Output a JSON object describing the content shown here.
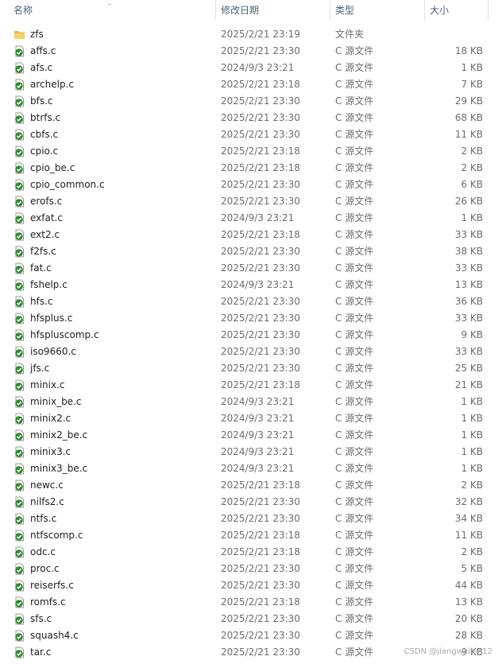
{
  "columns": {
    "name": "名称",
    "date": "修改日期",
    "type": "类型",
    "size": "大小"
  },
  "files": [
    {
      "name": "zfs",
      "date": "2025/2/21 23:19",
      "type": "文件夹",
      "size": "",
      "icon": "folder-icon"
    },
    {
      "name": "affs.c",
      "date": "2025/2/21 23:30",
      "type": "C 源文件",
      "size": "18 KB",
      "icon": "c-source-file-icon"
    },
    {
      "name": "afs.c",
      "date": "2024/9/3 23:21",
      "type": "C 源文件",
      "size": "1 KB",
      "icon": "c-source-file-icon"
    },
    {
      "name": "archelp.c",
      "date": "2025/2/21 23:18",
      "type": "C 源文件",
      "size": "7 KB",
      "icon": "c-source-file-icon"
    },
    {
      "name": "bfs.c",
      "date": "2025/2/21 23:30",
      "type": "C 源文件",
      "size": "29 KB",
      "icon": "c-source-file-icon"
    },
    {
      "name": "btrfs.c",
      "date": "2025/2/21 23:30",
      "type": "C 源文件",
      "size": "68 KB",
      "icon": "c-source-file-icon"
    },
    {
      "name": "cbfs.c",
      "date": "2025/2/21 23:30",
      "type": "C 源文件",
      "size": "11 KB",
      "icon": "c-source-file-icon"
    },
    {
      "name": "cpio.c",
      "date": "2025/2/21 23:18",
      "type": "C 源文件",
      "size": "2 KB",
      "icon": "c-source-file-icon"
    },
    {
      "name": "cpio_be.c",
      "date": "2025/2/21 23:18",
      "type": "C 源文件",
      "size": "2 KB",
      "icon": "c-source-file-icon"
    },
    {
      "name": "cpio_common.c",
      "date": "2025/2/21 23:30",
      "type": "C 源文件",
      "size": "6 KB",
      "icon": "c-source-file-icon"
    },
    {
      "name": "erofs.c",
      "date": "2025/2/21 23:30",
      "type": "C 源文件",
      "size": "26 KB",
      "icon": "c-source-file-icon"
    },
    {
      "name": "exfat.c",
      "date": "2024/9/3 23:21",
      "type": "C 源文件",
      "size": "1 KB",
      "icon": "c-source-file-icon"
    },
    {
      "name": "ext2.c",
      "date": "2025/2/21 23:18",
      "type": "C 源文件",
      "size": "33 KB",
      "icon": "c-source-file-icon"
    },
    {
      "name": "f2fs.c",
      "date": "2025/2/21 23:30",
      "type": "C 源文件",
      "size": "38 KB",
      "icon": "c-source-file-icon"
    },
    {
      "name": "fat.c",
      "date": "2025/2/21 23:30",
      "type": "C 源文件",
      "size": "33 KB",
      "icon": "c-source-file-icon"
    },
    {
      "name": "fshelp.c",
      "date": "2024/9/3 23:21",
      "type": "C 源文件",
      "size": "13 KB",
      "icon": "c-source-file-icon"
    },
    {
      "name": "hfs.c",
      "date": "2025/2/21 23:30",
      "type": "C 源文件",
      "size": "36 KB",
      "icon": "c-source-file-icon"
    },
    {
      "name": "hfsplus.c",
      "date": "2025/2/21 23:30",
      "type": "C 源文件",
      "size": "33 KB",
      "icon": "c-source-file-icon"
    },
    {
      "name": "hfspluscomp.c",
      "date": "2025/2/21 23:30",
      "type": "C 源文件",
      "size": "9 KB",
      "icon": "c-source-file-icon"
    },
    {
      "name": "iso9660.c",
      "date": "2025/2/21 23:30",
      "type": "C 源文件",
      "size": "33 KB",
      "icon": "c-source-file-icon"
    },
    {
      "name": "jfs.c",
      "date": "2025/2/21 23:30",
      "type": "C 源文件",
      "size": "25 KB",
      "icon": "c-source-file-icon"
    },
    {
      "name": "minix.c",
      "date": "2025/2/21 23:18",
      "type": "C 源文件",
      "size": "21 KB",
      "icon": "c-source-file-icon"
    },
    {
      "name": "minix_be.c",
      "date": "2024/9/3 23:21",
      "type": "C 源文件",
      "size": "1 KB",
      "icon": "c-source-file-icon"
    },
    {
      "name": "minix2.c",
      "date": "2024/9/3 23:21",
      "type": "C 源文件",
      "size": "1 KB",
      "icon": "c-source-file-icon"
    },
    {
      "name": "minix2_be.c",
      "date": "2024/9/3 23:21",
      "type": "C 源文件",
      "size": "1 KB",
      "icon": "c-source-file-icon"
    },
    {
      "name": "minix3.c",
      "date": "2024/9/3 23:21",
      "type": "C 源文件",
      "size": "1 KB",
      "icon": "c-source-file-icon"
    },
    {
      "name": "minix3_be.c",
      "date": "2024/9/3 23:21",
      "type": "C 源文件",
      "size": "1 KB",
      "icon": "c-source-file-icon"
    },
    {
      "name": "newc.c",
      "date": "2025/2/21 23:18",
      "type": "C 源文件",
      "size": "2 KB",
      "icon": "c-source-file-icon"
    },
    {
      "name": "nilfs2.c",
      "date": "2025/2/21 23:30",
      "type": "C 源文件",
      "size": "32 KB",
      "icon": "c-source-file-icon"
    },
    {
      "name": "ntfs.c",
      "date": "2025/2/21 23:30",
      "type": "C 源文件",
      "size": "34 KB",
      "icon": "c-source-file-icon"
    },
    {
      "name": "ntfscomp.c",
      "date": "2025/2/21 23:18",
      "type": "C 源文件",
      "size": "11 KB",
      "icon": "c-source-file-icon"
    },
    {
      "name": "odc.c",
      "date": "2025/2/21 23:18",
      "type": "C 源文件",
      "size": "2 KB",
      "icon": "c-source-file-icon"
    },
    {
      "name": "proc.c",
      "date": "2025/2/21 23:30",
      "type": "C 源文件",
      "size": "5 KB",
      "icon": "c-source-file-icon"
    },
    {
      "name": "reiserfs.c",
      "date": "2025/2/21 23:30",
      "type": "C 源文件",
      "size": "44 KB",
      "icon": "c-source-file-icon"
    },
    {
      "name": "romfs.c",
      "date": "2025/2/21 23:18",
      "type": "C 源文件",
      "size": "13 KB",
      "icon": "c-source-file-icon"
    },
    {
      "name": "sfs.c",
      "date": "2025/2/21 23:30",
      "type": "C 源文件",
      "size": "20 KB",
      "icon": "c-source-file-icon"
    },
    {
      "name": "squash4.c",
      "date": "2025/2/21 23:30",
      "type": "C 源文件",
      "size": "28 KB",
      "icon": "c-source-file-icon"
    },
    {
      "name": "tar.c",
      "date": "2025/2/21 23:30",
      "type": "C 源文件",
      "size": "9 KB",
      "icon": "c-source-file-icon"
    }
  ],
  "watermark": "CSDN @jiangweibin12",
  "colors": {
    "folder": "#f1c44e",
    "source_icon": "#2e8b2e",
    "header_text": "#4c607a"
  }
}
